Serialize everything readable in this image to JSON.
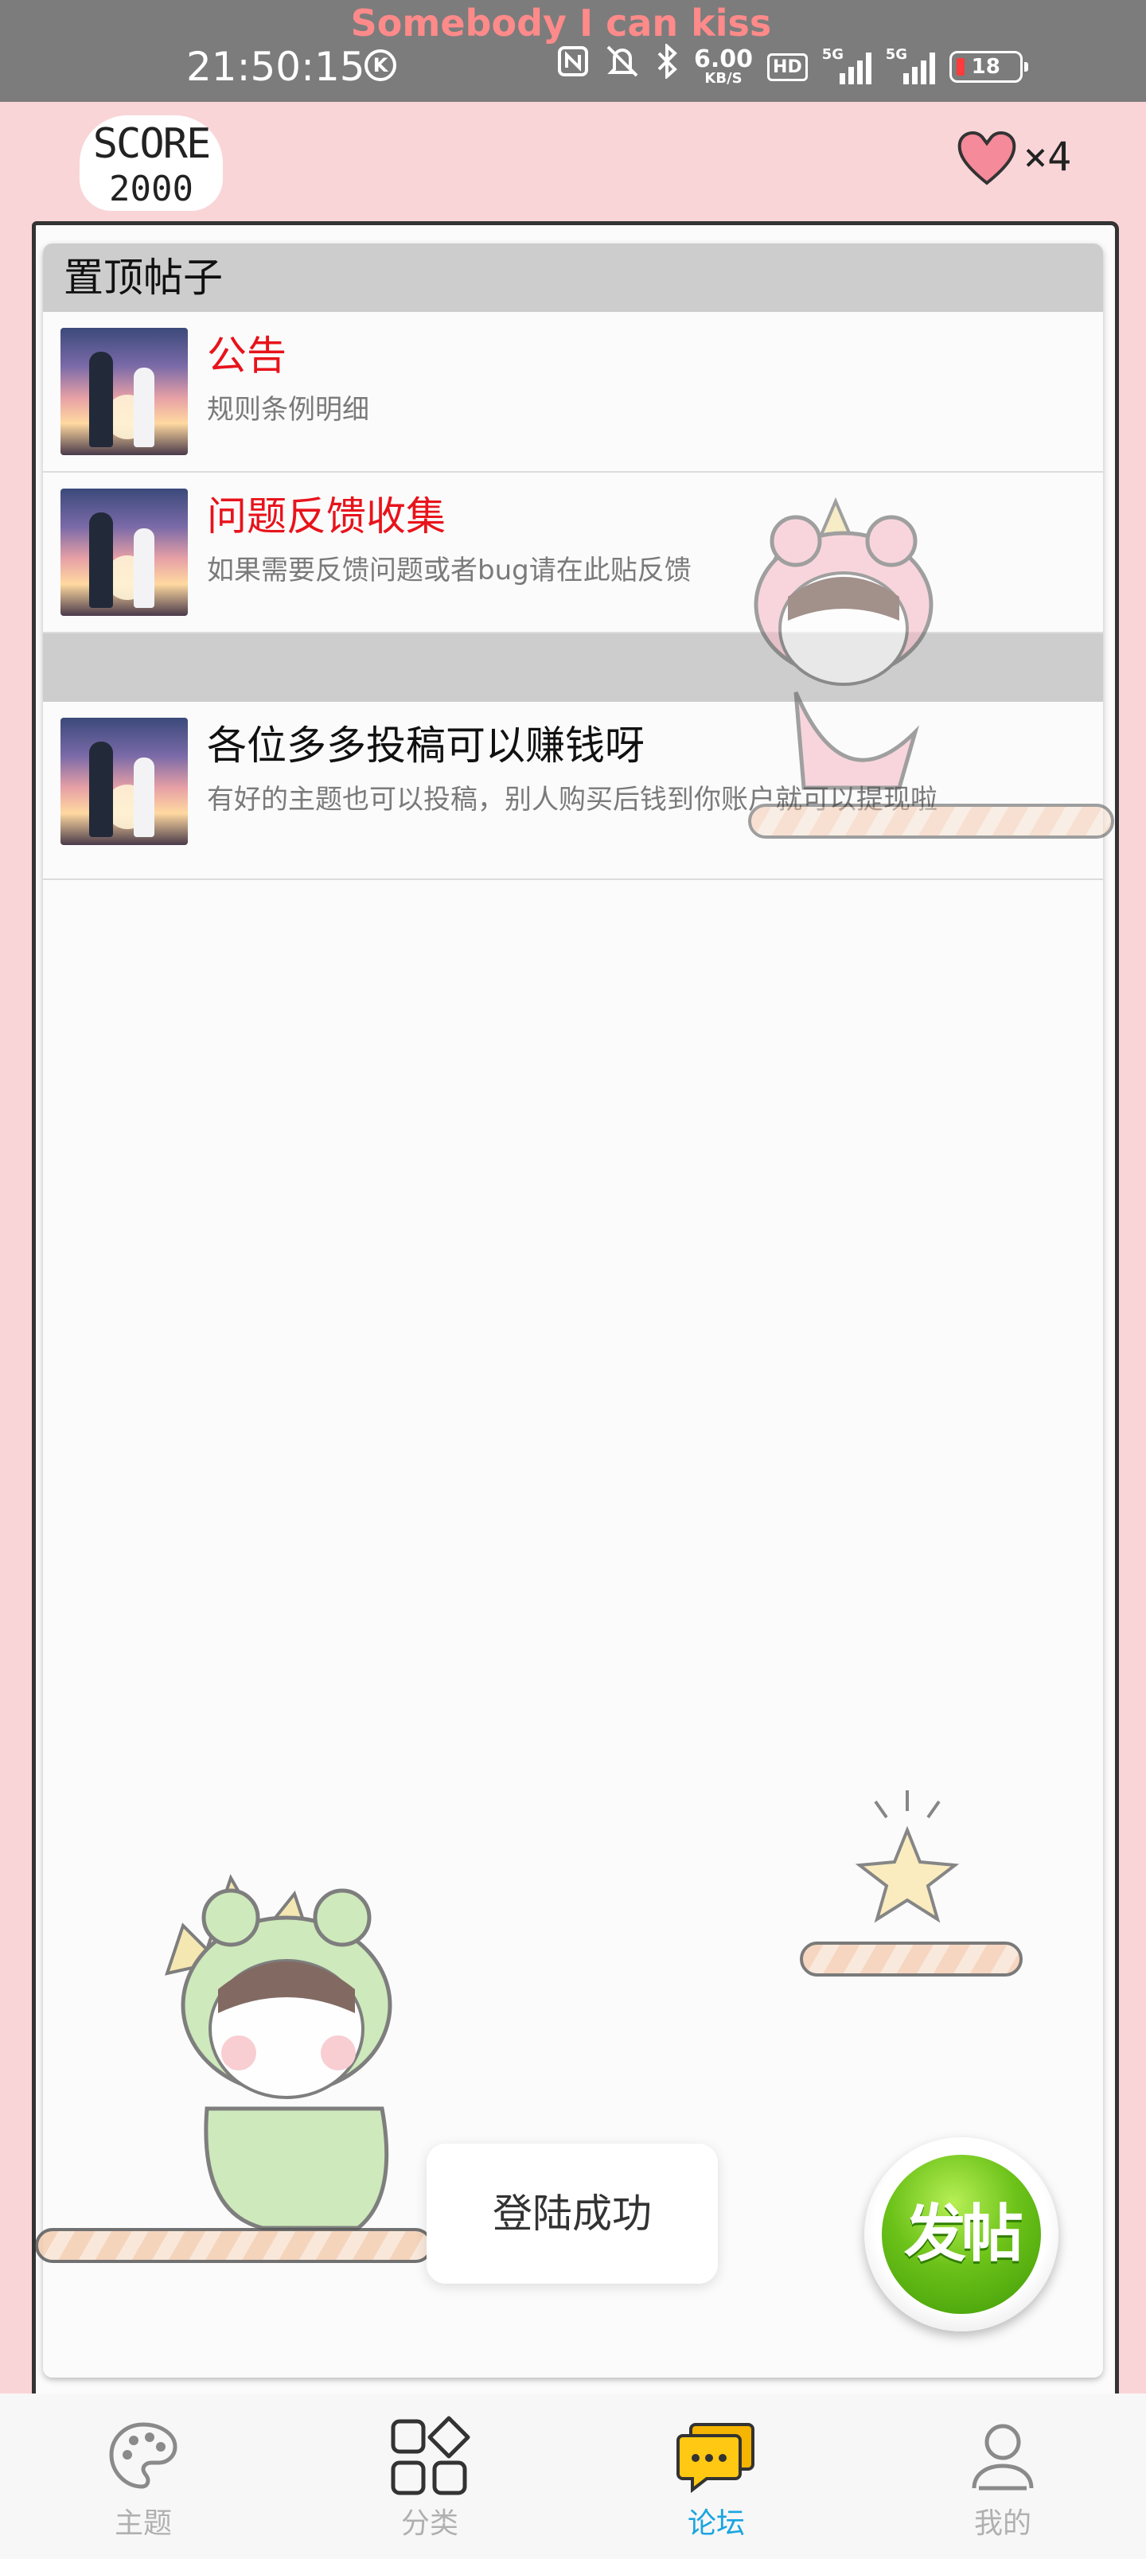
{
  "status_bar": {
    "lyric": "Somebody I can kiss",
    "time": "21:50:15",
    "k_badge": "K",
    "net_speed_value": "6.00",
    "net_speed_unit": "KB/S",
    "hd_label": "HD",
    "signal1_label": "5G",
    "signal2_label": "5G",
    "battery": "18"
  },
  "decor": {
    "score_label": "SCORE",
    "score_value": "2000",
    "lives_label": "×4"
  },
  "forum": {
    "pinned_header": "置顶帖子",
    "pinned_posts": [
      {
        "title": "公告",
        "subtitle": "规则条例明细"
      },
      {
        "title": "问题反馈收集",
        "subtitle": "如果需要反馈问题或者bug请在此贴反馈"
      }
    ],
    "posts": [
      {
        "title": "各位多多投稿可以赚钱呀",
        "subtitle": "有好的主题也可以投稿，别人购买后钱到你账户就可以提现啦"
      }
    ]
  },
  "toast": "登陆成功",
  "fab_label": "发帖",
  "nav": {
    "items": [
      {
        "label": "主题",
        "icon": "palette-icon"
      },
      {
        "label": "分类",
        "icon": "grid-icon"
      },
      {
        "label": "论坛",
        "icon": "chat-bubbles-icon"
      },
      {
        "label": "我的",
        "icon": "person-icon"
      }
    ],
    "active_index": 2,
    "active_color": "#1aa5e0",
    "inactive_color": "#b0b0b0"
  }
}
